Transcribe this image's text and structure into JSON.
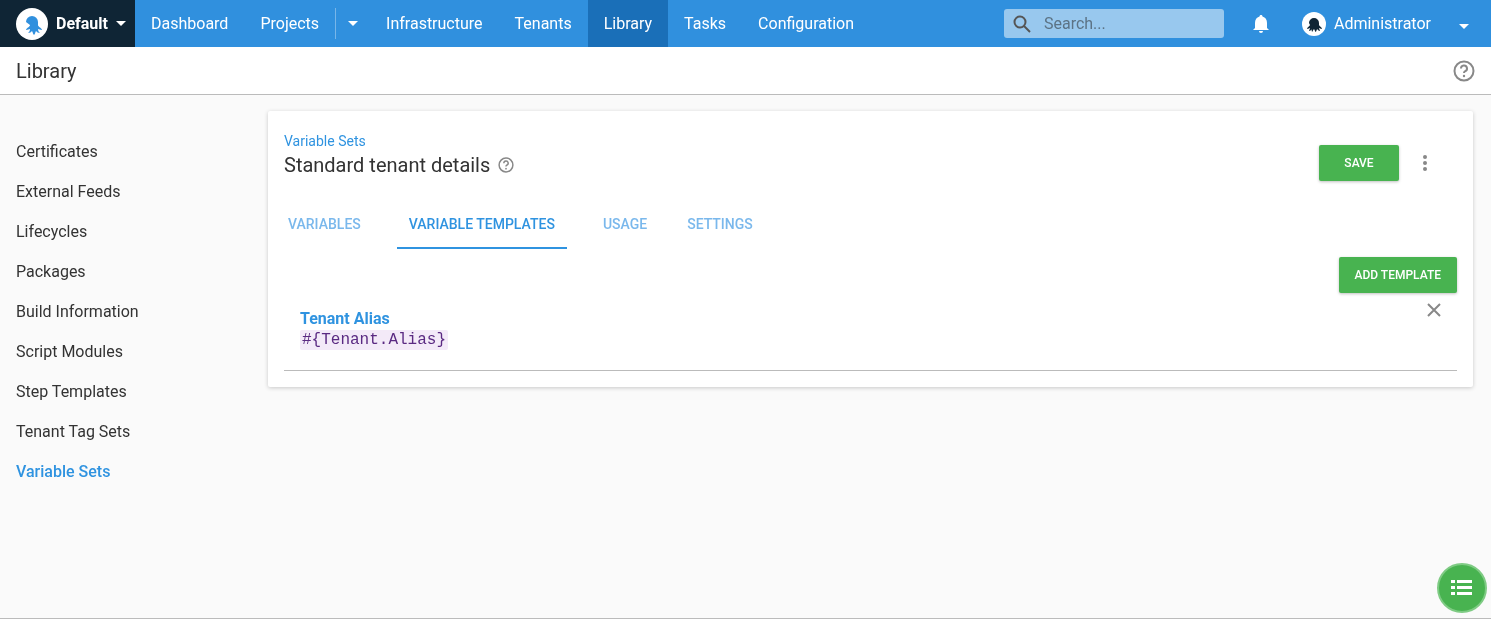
{
  "topbar": {
    "space": "Default",
    "nav": [
      {
        "label": "Dashboard",
        "selected": false,
        "dropdown": false
      },
      {
        "label": "Projects",
        "selected": false,
        "dropdown": true
      },
      {
        "label": "Infrastructure",
        "selected": false,
        "dropdown": false
      },
      {
        "label": "Tenants",
        "selected": false,
        "dropdown": false
      },
      {
        "label": "Library",
        "selected": true,
        "dropdown": false
      },
      {
        "label": "Tasks",
        "selected": false,
        "dropdown": false
      },
      {
        "label": "Configuration",
        "selected": false,
        "dropdown": false
      }
    ],
    "search": {
      "placeholder": "Search..."
    },
    "user": "Administrator"
  },
  "page_title": "Library",
  "sidebar": {
    "items": [
      {
        "label": "Certificates",
        "selected": false
      },
      {
        "label": "External Feeds",
        "selected": false
      },
      {
        "label": "Lifecycles",
        "selected": false
      },
      {
        "label": "Packages",
        "selected": false
      },
      {
        "label": "Build Information",
        "selected": false
      },
      {
        "label": "Script Modules",
        "selected": false
      },
      {
        "label": "Step Templates",
        "selected": false
      },
      {
        "label": "Tenant Tag Sets",
        "selected": false
      },
      {
        "label": "Variable Sets",
        "selected": true
      }
    ]
  },
  "card": {
    "breadcrumb": "Variable Sets",
    "title": "Standard tenant details",
    "save_button": "SAVE",
    "tabs": [
      {
        "label": "VARIABLES",
        "selected": false
      },
      {
        "label": "VARIABLE TEMPLATES",
        "selected": true
      },
      {
        "label": "USAGE",
        "selected": false
      },
      {
        "label": "SETTINGS",
        "selected": false
      }
    ],
    "add_button": "ADD TEMPLATE",
    "templates": [
      {
        "name": "Tenant Alias",
        "expression": "#{Tenant.Alias}"
      }
    ]
  }
}
